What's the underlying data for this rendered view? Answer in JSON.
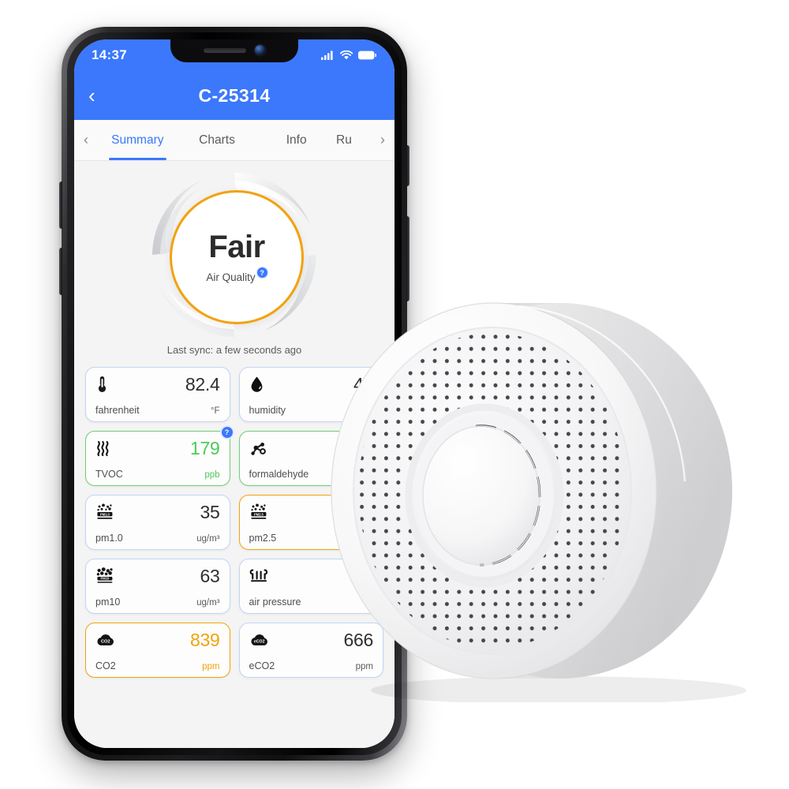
{
  "status_bar": {
    "time": "14:37",
    "icons": [
      "cellular-signal-icon",
      "wifi-icon",
      "battery-icon"
    ]
  },
  "nav": {
    "back_icon": "chevron-left-icon",
    "title": "C-25314"
  },
  "tabbar": {
    "prev_arrow": "‹",
    "next_arrow": "›",
    "tabs": [
      {
        "label": "Summary",
        "active": true
      },
      {
        "label": "Charts",
        "active": false
      },
      {
        "label": "Info",
        "active": false
      },
      {
        "label": "Ru",
        "active": false
      }
    ]
  },
  "gauge": {
    "value_label": "Fair",
    "caption": "Air Quality",
    "info_badge": "?",
    "ring_color": "#f2a20c"
  },
  "sync": {
    "text": "Last sync: a few seconds ago"
  },
  "cards": [
    {
      "name": "fahrenheit",
      "value": "82.4",
      "unit": "°F",
      "icon": "thermometer-icon",
      "state": "blue",
      "badge": null
    },
    {
      "name": "humidity",
      "value": "41",
      "unit": "",
      "icon": "water-drop-icon",
      "state": "blue",
      "badge": null
    },
    {
      "name": "TVOC",
      "value": "179",
      "unit": "ppb",
      "icon": "vapor-waves-icon",
      "state": "green",
      "badge": "?"
    },
    {
      "name": "formaldehyde",
      "value": "",
      "unit": "",
      "icon": "molecule-icon",
      "state": "green",
      "badge": null
    },
    {
      "name": "pm1.0",
      "value": "35",
      "unit": "ug/m³",
      "icon": "particles-pm1-icon",
      "state": "blue",
      "badge": null
    },
    {
      "name": "pm2.5",
      "value": "",
      "unit": "",
      "icon": "particles-pm25-icon",
      "state": "amber",
      "badge": null
    },
    {
      "name": "pm10",
      "value": "63",
      "unit": "ug/m³",
      "icon": "particles-pm10-icon",
      "state": "blue",
      "badge": null
    },
    {
      "name": "air pressure",
      "value": "",
      "unit": "",
      "icon": "barometer-icon",
      "state": "blue",
      "badge": null
    },
    {
      "name": "CO2",
      "value": "839",
      "unit": "ppm",
      "icon": "co2-cloud-icon",
      "state": "amber",
      "badge": null
    },
    {
      "name": "eCO2",
      "value": "666",
      "unit": "ppm",
      "icon": "eco2-cloud-icon",
      "state": "blue",
      "badge": null
    }
  ],
  "device": {
    "name": "air-quality-sensor-device"
  },
  "colors": {
    "brand_blue": "#3b78fb",
    "amber": "#f2a20c",
    "green": "#4cc95a",
    "card_border_blue": "#c2d4f5",
    "page_bg": "#f4f4f4"
  }
}
